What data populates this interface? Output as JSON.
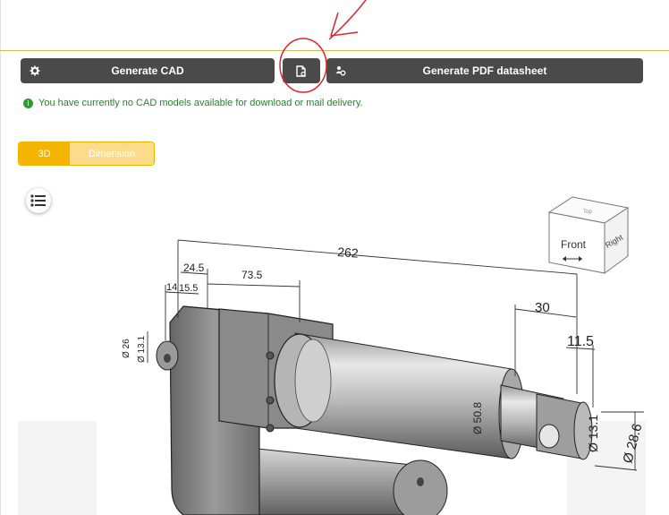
{
  "toolbar": {
    "generate_cad_label": "Generate CAD",
    "generate_pdf_label": "Generate PDF datasheet",
    "cad_icon": "gear-icon",
    "file_icon": "file-settings-icon",
    "pdf_icon": "users-settings-icon"
  },
  "notice": {
    "text": "You have currently no CAD models available for download or mail delivery.",
    "icon": "info-icon",
    "color": "#2e7d32"
  },
  "viewer": {
    "tabs": [
      "3D",
      "Dimension"
    ],
    "active_tab": "3D",
    "menu_icon": "list-icon",
    "accent": "#f5b400"
  },
  "view_cube": {
    "front": "Front",
    "right": "Right",
    "top": "Top"
  },
  "dimensions": {
    "d262": "262",
    "d24_5": "24.5",
    "d73_5": "73.5",
    "d14": "14",
    "d15_5": "15.5",
    "d30": "30",
    "d11_5": "11.5",
    "d26": "Ø 26",
    "d13_1_left": "Ø 13.1",
    "d50_8": "Ø 50.8",
    "d13_1_right": "Ø 13.1",
    "d28_6": "Ø 28.6"
  },
  "annotation": {
    "color": "#e0242a"
  }
}
